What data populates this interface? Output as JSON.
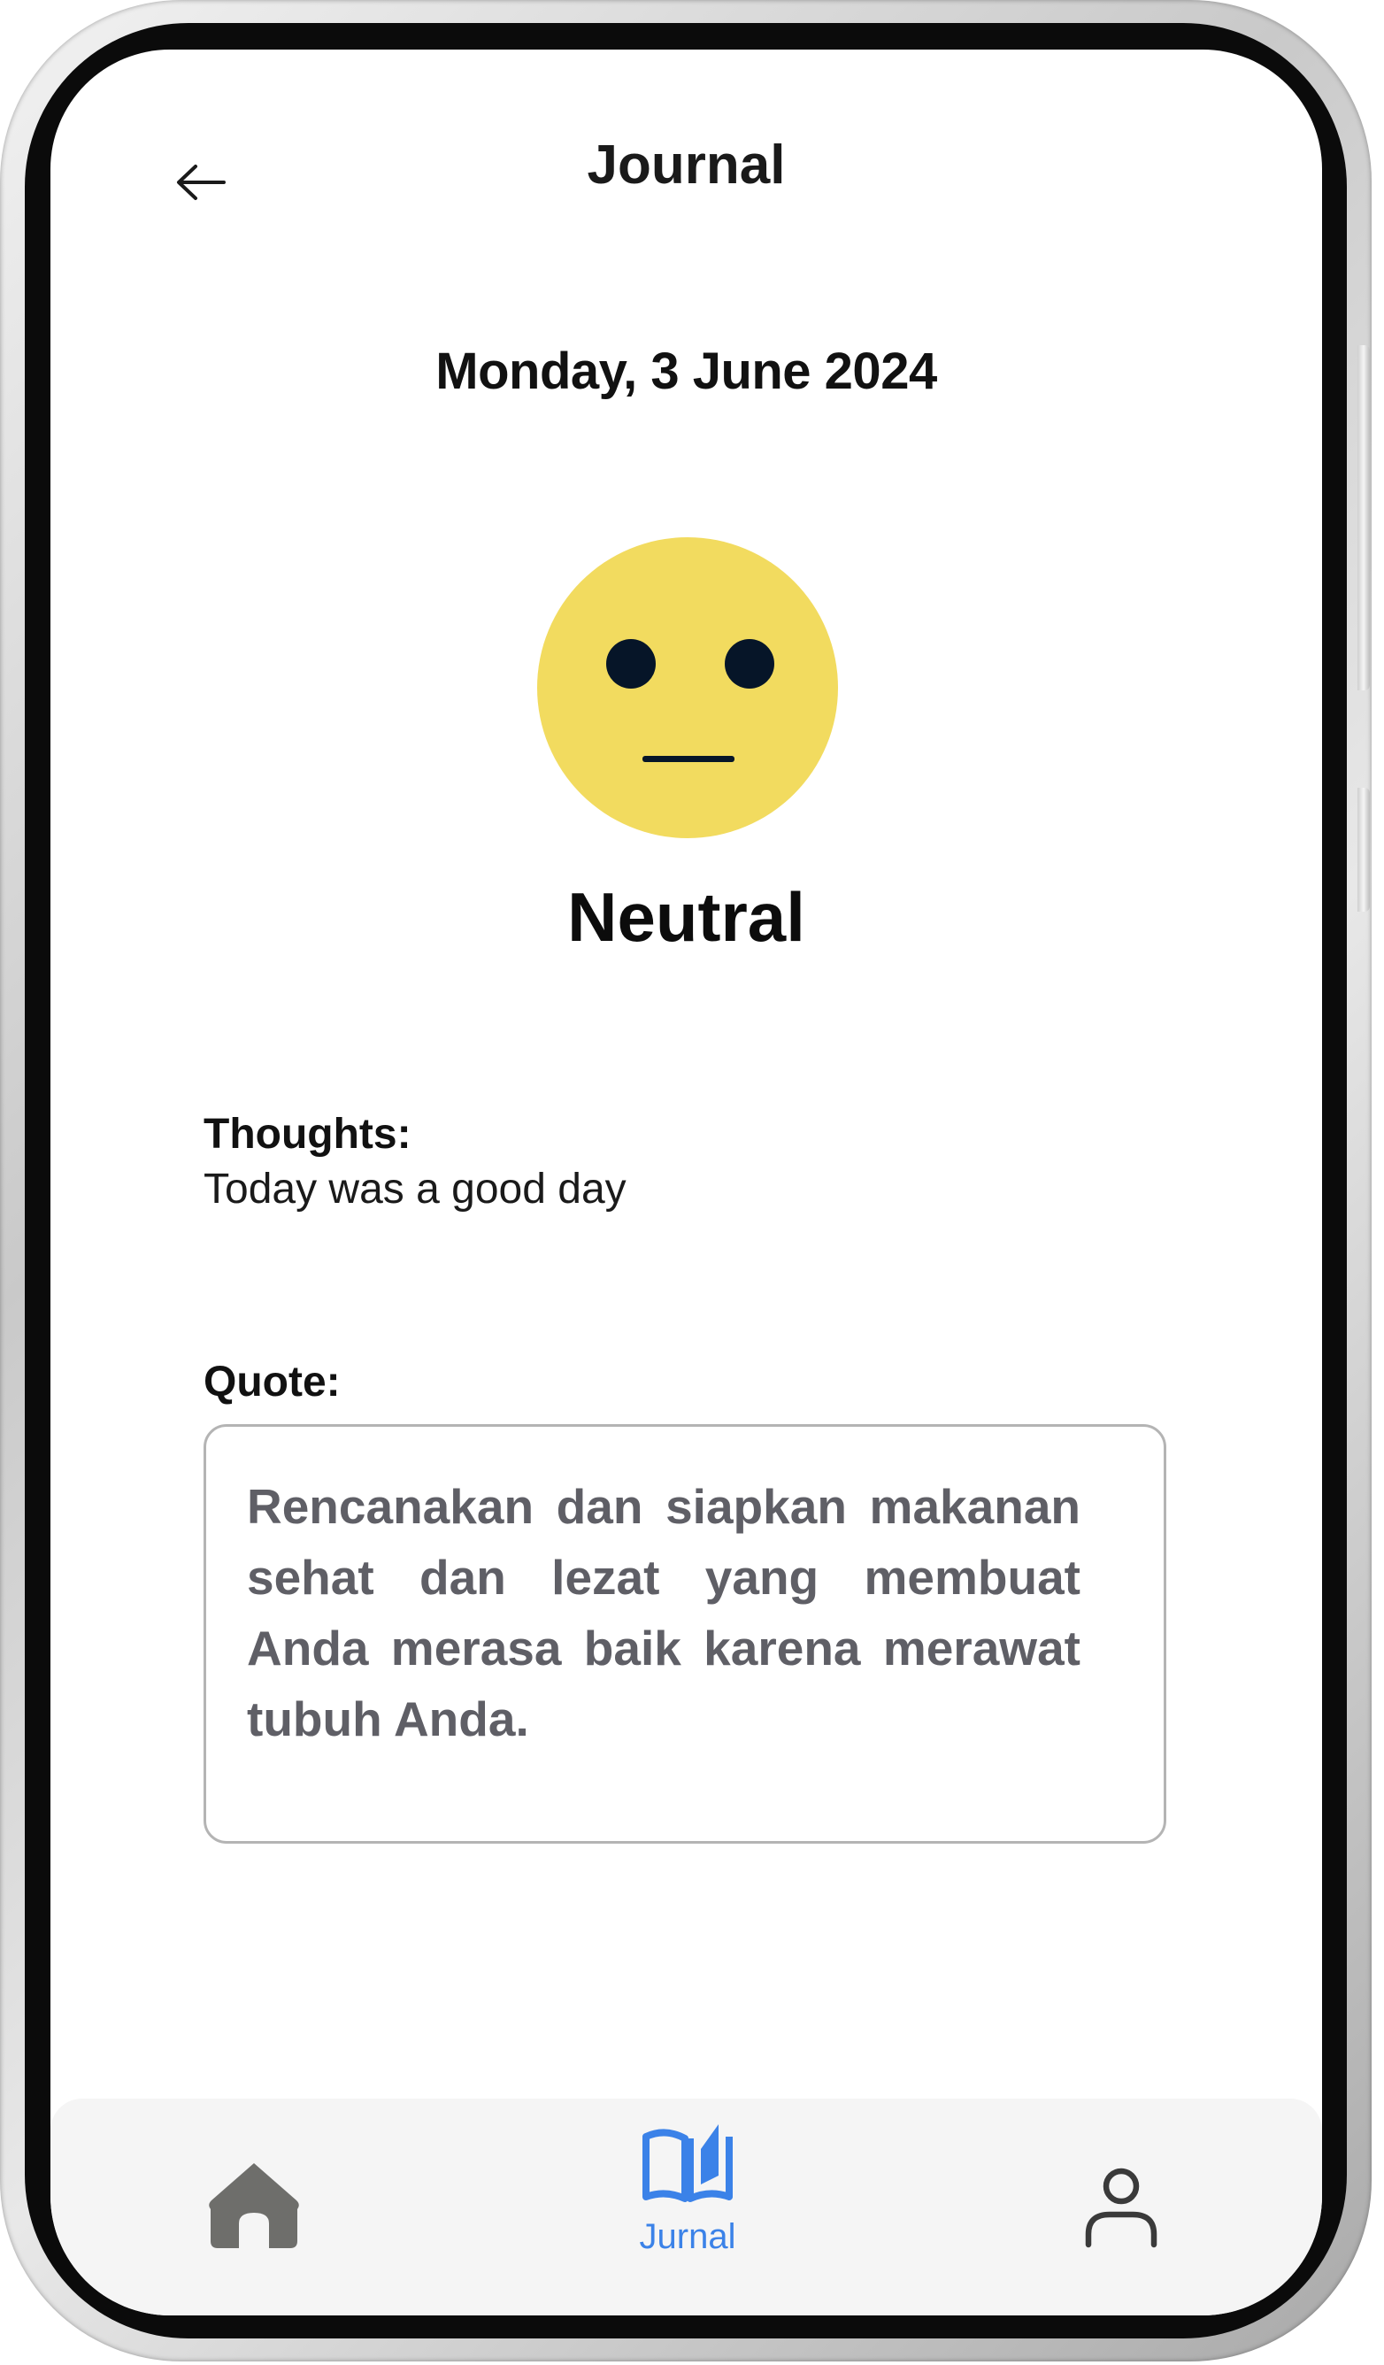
{
  "header": {
    "title": "Journal"
  },
  "entry": {
    "date": "Monday, 3 June 2024",
    "mood": "Neutral",
    "mood_icon": "neutral-face-icon",
    "mood_color": "#F2DB5F",
    "thoughts_label": "Thoughts:",
    "thoughts_text": "Today was a good day",
    "quote_label": "Quote:",
    "quote_text": "Rencanakan dan siapkan makanan sehat dan lezat yang membuat Anda merasa baik karena merawat tubuh Anda."
  },
  "bottom_nav": {
    "items": [
      {
        "icon": "home-icon",
        "label": "",
        "active": false
      },
      {
        "icon": "open-book-icon",
        "label": "Jurnal",
        "active": true
      },
      {
        "icon": "user-icon",
        "label": "",
        "active": false
      }
    ],
    "active_color": "#3B82E8",
    "inactive_color": "#6E6E6B"
  }
}
